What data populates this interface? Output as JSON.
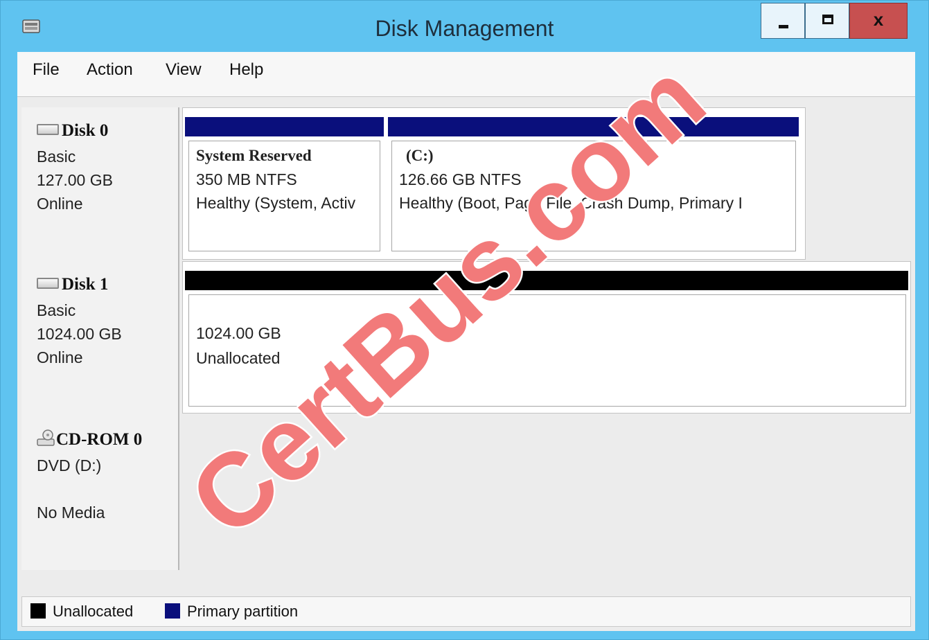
{
  "window": {
    "title": "Disk Management",
    "minimize_glyph": "",
    "maximize_glyph": "",
    "close_glyph": "x"
  },
  "menu": [
    "File",
    "Action",
    "View",
    "Help"
  ],
  "disks": [
    {
      "name": "Disk 0",
      "icon": "hard-disk-icon",
      "lines": [
        "Basic",
        "127.00 GB",
        "Online"
      ],
      "volumes": [
        {
          "name": "System Reserved",
          "size": "350 MB NTFS",
          "status": "Healthy (System, Activ",
          "bar_color": "#0a0f7c"
        },
        {
          "name": "(C:)",
          "size": "126.66 GB NTFS",
          "status": "Healthy (Boot, Page File, Crash Dump, Primary I",
          "bar_color": "#0a0f7c"
        }
      ]
    },
    {
      "name": "Disk 1",
      "icon": "hard-disk-icon",
      "lines": [
        "Basic",
        "1024.00 GB",
        "Online"
      ],
      "volumes": [
        {
          "name": "",
          "size": "1024.00 GB",
          "status": "Unallocated",
          "bar_color": "#000000"
        }
      ]
    },
    {
      "name": "CD-ROM 0",
      "icon": "cd-drive-icon",
      "lines": [
        "DVD (D:)",
        "",
        "No Media"
      ],
      "volumes": []
    }
  ],
  "legend": [
    {
      "label": "Unallocated",
      "color": "#000000"
    },
    {
      "label": "Primary partition",
      "color": "#0a0f7c"
    }
  ],
  "watermark": "CertBus.com"
}
